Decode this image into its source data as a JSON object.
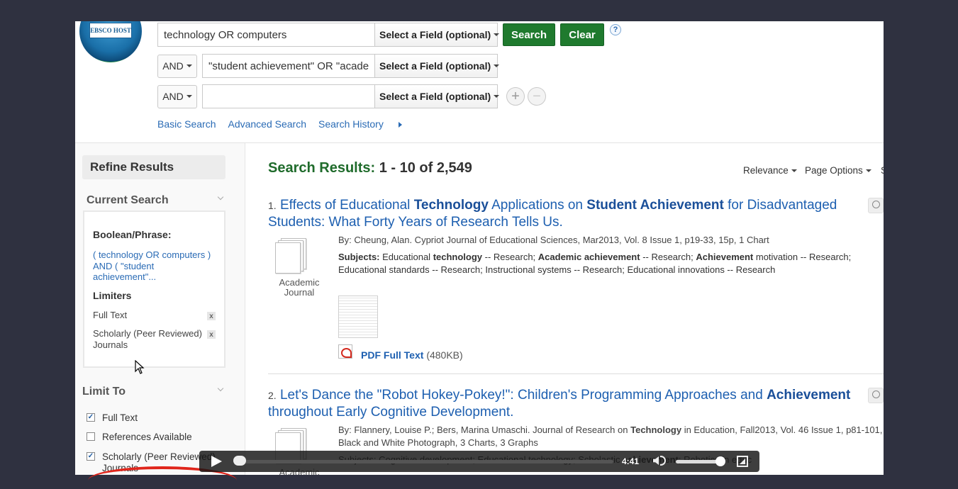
{
  "logo": {
    "text": "EBSCO HOST"
  },
  "search_rows": [
    {
      "bool": "",
      "value": "technology OR computers",
      "field": "Select a Field (optional)"
    },
    {
      "bool": "AND",
      "value": "\"student achievement\" OR \"acade",
      "field": "Select a Field (optional)"
    },
    {
      "bool": "AND",
      "value": "",
      "field": "Select a Field (optional)"
    }
  ],
  "buttons": {
    "search": "Search",
    "clear": "Clear",
    "help": "?",
    "add": "+",
    "remove": "−"
  },
  "links": {
    "basic": "Basic Search",
    "advanced": "Advanced Search",
    "history": "Search History"
  },
  "sidebar": {
    "refine_title": "Refine Results",
    "current_search_title": "Current Search",
    "boolean_label": "Boolean/Phrase:",
    "boolean_query": "( technology OR computers ) AND ( \"student achievement\"...",
    "limiters_label": "Limiters",
    "limiters": [
      {
        "label": "Full Text"
      },
      {
        "label": "Scholarly (Peer Reviewed) Journals"
      }
    ],
    "limit_to_title": "Limit To",
    "limit_options": [
      {
        "label": "Full Text",
        "checked": true
      },
      {
        "label": "References Available",
        "checked": false
      },
      {
        "label": "Scholarly (Peer Reviewed) Journals",
        "checked": true
      }
    ],
    "remove_label": "x"
  },
  "results_header": {
    "label": "Search Results:",
    "count": "1 - 10 of 2,549"
  },
  "tools": {
    "relevance": "Relevance",
    "page_options": "Page Options",
    "share": "S"
  },
  "results": [
    {
      "num": "1.",
      "title_parts": [
        {
          "t": "Effects of Educational ",
          "b": false
        },
        {
          "t": "Technology",
          "b": true
        },
        {
          "t": " Applications on ",
          "b": false
        },
        {
          "t": "Student Achievement",
          "b": true
        },
        {
          "t": " for Disadvantaged Students: What Forty Years of Research Tells Us.",
          "b": false
        }
      ],
      "by": "By: Cheung, Alan. Cypriot Journal of Educational Sciences, Mar2013, Vol. 8 Issue 1, p19-33, 15p, 1 Chart",
      "subjects_label": "Subjects:",
      "subjects_parts": [
        {
          "t": " Educational ",
          "b": false
        },
        {
          "t": "technology",
          "b": true
        },
        {
          "t": " -- Research; ",
          "b": false
        },
        {
          "t": "Academic achievement",
          "b": true
        },
        {
          "t": " -- Research; ",
          "b": false
        },
        {
          "t": "Achievement",
          "b": true
        },
        {
          "t": " motivation -- Research; Educational standards -- Research; Instructional systems -- Research; Educational innovations -- Research",
          "b": false
        }
      ],
      "type": "Academic Journal",
      "pdf_label": "PDF Full Text",
      "pdf_size": "(480KB)"
    },
    {
      "num": "2.",
      "title_parts": [
        {
          "t": "Let's Dance the \"Robot Hokey-Pokey!\": Children's Programming Approaches and ",
          "b": false
        },
        {
          "t": "Achievement",
          "b": true
        },
        {
          "t": " throughout Early Cognitive Development.",
          "b": false
        }
      ],
      "by_parts": [
        {
          "t": "By: Flannery, Louise P.; Bers, Marina Umaschi. Journal of Research on ",
          "b": false
        },
        {
          "t": "Technology",
          "b": true
        },
        {
          "t": " in Education, Fall2013, Vol. 46 Issue 1, p81-101,",
          "b": false
        }
      ],
      "by2": "Black and White Photograph, 3 Charts, 3 Graphs",
      "subj2_parts": [
        {
          "t": "Subjects: Cognitive development; Educational technology; Scholastic ",
          "b": false
        },
        {
          "t": "achievement",
          "b": true
        },
        {
          "t": "; Robotics in educ",
          "b": false
        }
      ],
      "type": "Academic"
    }
  ],
  "video": {
    "time": "4:41",
    "progress": 0.03,
    "volume": 0.9
  }
}
